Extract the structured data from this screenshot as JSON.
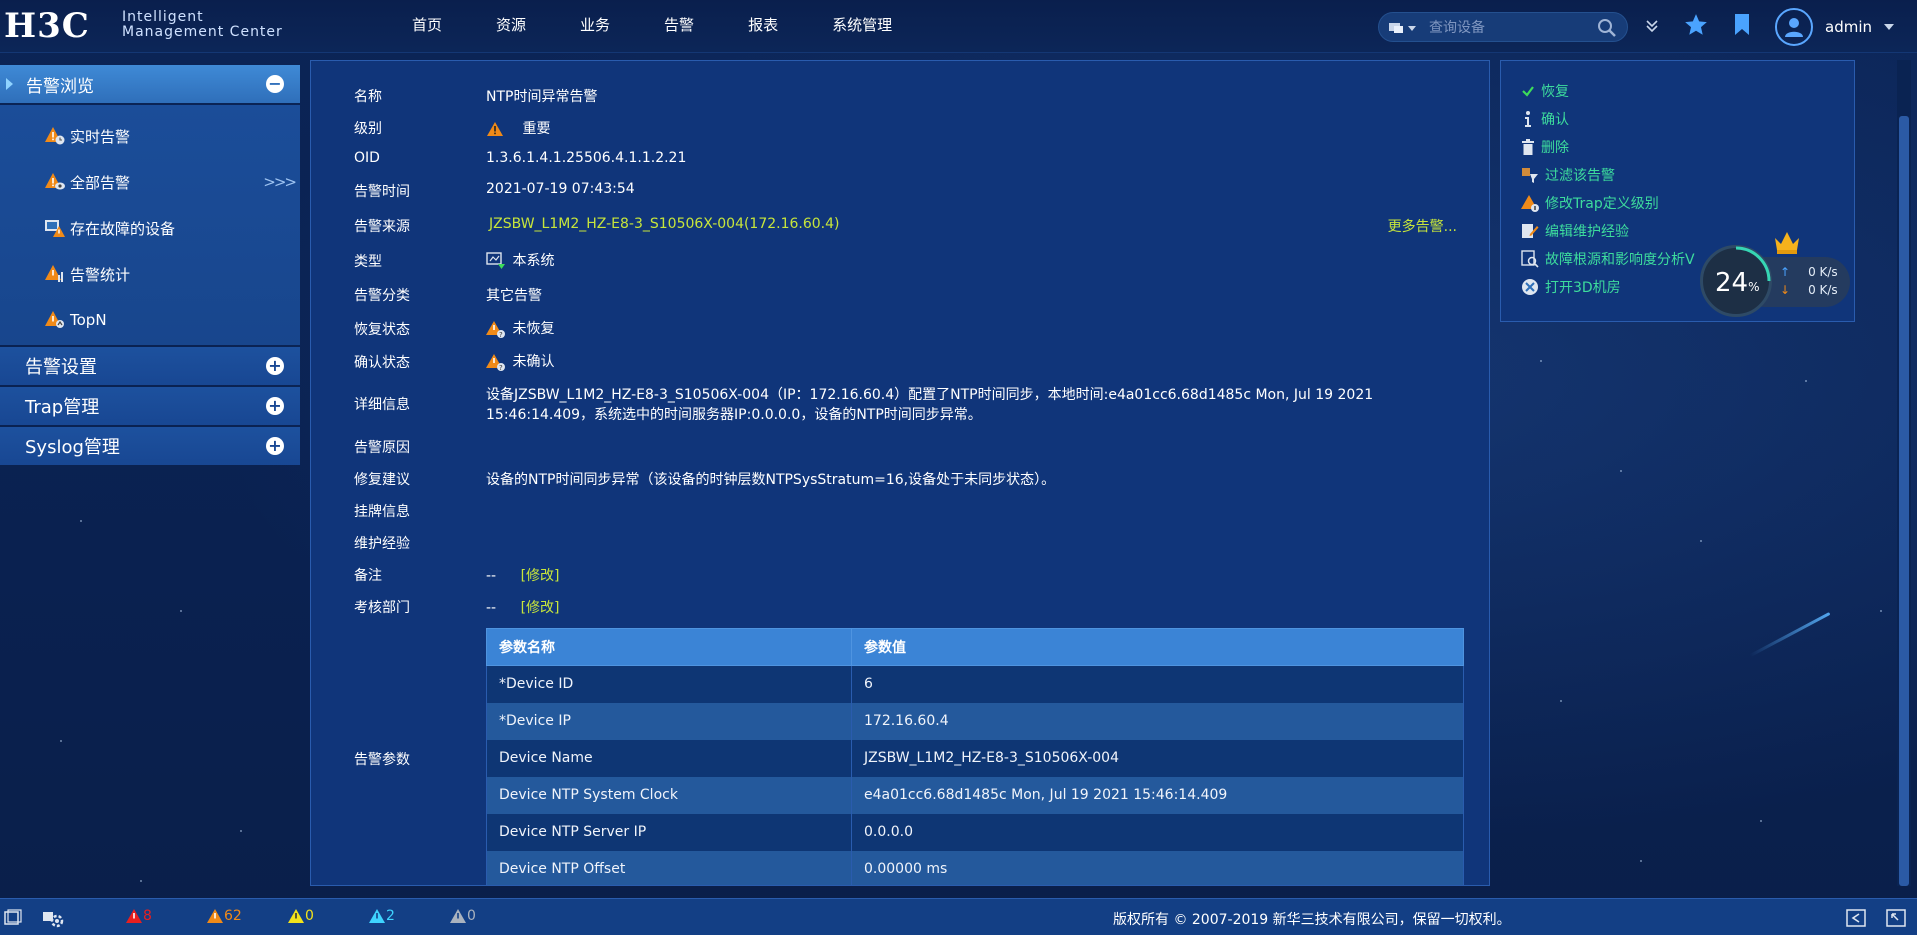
{
  "header": {
    "logo_mark": "H3C",
    "logo_line1": "Intelligent",
    "logo_line2": "Management Center",
    "nav": [
      "首页",
      "资源",
      "业务",
      "告警",
      "报表",
      "系统管理"
    ],
    "search_placeholder": "查询设备",
    "user_name": "admin"
  },
  "sidebar": {
    "section_title": "告警浏览",
    "items": [
      {
        "label": "实时告警",
        "icon": "realtime-alarm-icon"
      },
      {
        "label": "全部告警",
        "icon": "all-alarm-icon"
      },
      {
        "label": "存在故障的设备",
        "icon": "faulty-device-icon"
      },
      {
        "label": "告警统计",
        "icon": "alarm-stat-icon"
      },
      {
        "label": "TopN",
        "icon": "topn-icon"
      }
    ],
    "chevron": ">>>",
    "groups": [
      "告警设置",
      "Trap管理",
      "Syslog管理"
    ]
  },
  "detail": {
    "name_label": "名称",
    "name_value": "NTP时间异常告警",
    "level_label": "级别",
    "level_value": "重要",
    "oid_label": "OID",
    "oid_value": "1.3.6.1.4.1.25506.4.1.1.2.21",
    "time_label": "告警时间",
    "time_value": "2021-07-19 07:43:54",
    "source_label": "告警来源",
    "source_value": "JZSBW_L1M2_HZ-E8-3_S10506X-004(172.16.60.4)",
    "more_alarms": "更多告警...",
    "type_label": "类型",
    "type_value": "本系统",
    "category_label": "告警分类",
    "category_value": "其它告警",
    "recover_label": "恢复状态",
    "recover_value": "未恢复",
    "confirm_label": "确认状态",
    "confirm_value": "未确认",
    "info_label": "详细信息",
    "info_line1": "设备JZSBW_L1M2_HZ-E8-3_S10506X-004（IP：172.16.60.4）配置了NTP时间同步，本地时间:e4a01cc6.68d1485c Mon, Jul 19 2021",
    "info_line2": "15:46:14.409，系统选中的时间服务器IP:0.0.0.0，设备的NTP时间同步异常。",
    "reason_label": "告警原因",
    "suggest_label": "修复建议",
    "suggest_value": "设备的NTP时间同步异常（该设备的时钟层数NTPSysStratum=16,设备处于未同步状态）。",
    "tag_label": "挂牌信息",
    "maint_label": "维护经验",
    "remark_label": "备注",
    "remark_value": "--",
    "remark_edit": "[修改]",
    "dept_label": "考核部门",
    "dept_value": "--",
    "dept_edit": "[修改]",
    "params_label": "告警参数"
  },
  "params": {
    "col_name": "参数名称",
    "col_value": "参数值",
    "rows": [
      {
        "name": "*Device ID",
        "value": "6"
      },
      {
        "name": "*Device IP",
        "value": "172.16.60.4"
      },
      {
        "name": "Device Name",
        "value": "JZSBW_L1M2_HZ-E8-3_S10506X-004"
      },
      {
        "name": "Device NTP System Clock",
        "value": "e4a01cc6.68d1485c Mon, Jul 19 2021 15:46:14.409"
      },
      {
        "name": "Device NTP Server IP",
        "value": "0.0.0.0"
      },
      {
        "name": "Device NTP Offset",
        "value": "0.00000 ms"
      }
    ]
  },
  "actions": [
    {
      "label": "恢复",
      "icon": "check-icon"
    },
    {
      "label": "确认",
      "icon": "info-icon"
    },
    {
      "label": "删除",
      "icon": "trash-icon"
    },
    {
      "label": "过滤该告警",
      "icon": "filter-icon"
    },
    {
      "label": "修改Trap定义级别",
      "icon": "trap-level-icon"
    },
    {
      "label": "编辑维护经验",
      "icon": "edit-icon"
    },
    {
      "label": "故障根源和影响度分析V",
      "icon": "analysis-icon"
    },
    {
      "label": "打开3D机房",
      "icon": "3d-room-icon"
    }
  ],
  "speed_widget": {
    "percent": "24",
    "percent_sign": "%",
    "up": "0 K/s",
    "down": "0 K/s"
  },
  "footer": {
    "red_count": "8",
    "orange_count": "62",
    "yellow_count": "0",
    "cyan_count": "2",
    "gray_count": "0",
    "copyright": "版权所有 © 2007-2019 新华三技术有限公司，保留一切权利。"
  },
  "colors": {
    "accent_green": "#3ddc9d",
    "link_lime": "#c7e53b",
    "panel_bg": "#10357a",
    "header_blue": "#3b84d6"
  }
}
